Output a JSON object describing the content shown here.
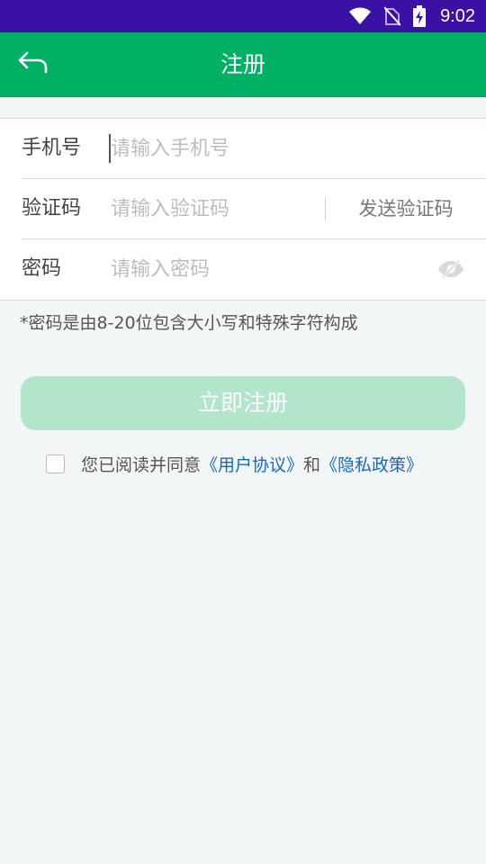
{
  "status_bar": {
    "time": "9:02",
    "icons": [
      "wifi-icon",
      "no-sim-icon",
      "battery-charging-icon"
    ]
  },
  "app_bar": {
    "back_icon": "back-arrow-icon",
    "title": "注册"
  },
  "form": {
    "phone": {
      "label": "手机号",
      "placeholder": "请输入手机号",
      "value": ""
    },
    "code": {
      "label": "验证码",
      "placeholder": "请输入验证码",
      "value": "",
      "send_label": "发送验证码"
    },
    "password": {
      "label": "密码",
      "placeholder": "请输入密码",
      "value": "",
      "toggle_icon": "eye-hidden-icon"
    }
  },
  "hint": "*密码是由8-20位包含大小写和特殊字符构成",
  "register_button": "立即注册",
  "agreement": {
    "checked": false,
    "prefix": "您已阅读并同意",
    "user_agreement": "《用户协议》",
    "and": "和",
    "privacy_policy": "《隐私政策》"
  },
  "colors": {
    "status_bar": "#3b10a5",
    "app_bar": "#00b165",
    "button_disabled": "#b2e5c9",
    "link": "#1469c7"
  }
}
